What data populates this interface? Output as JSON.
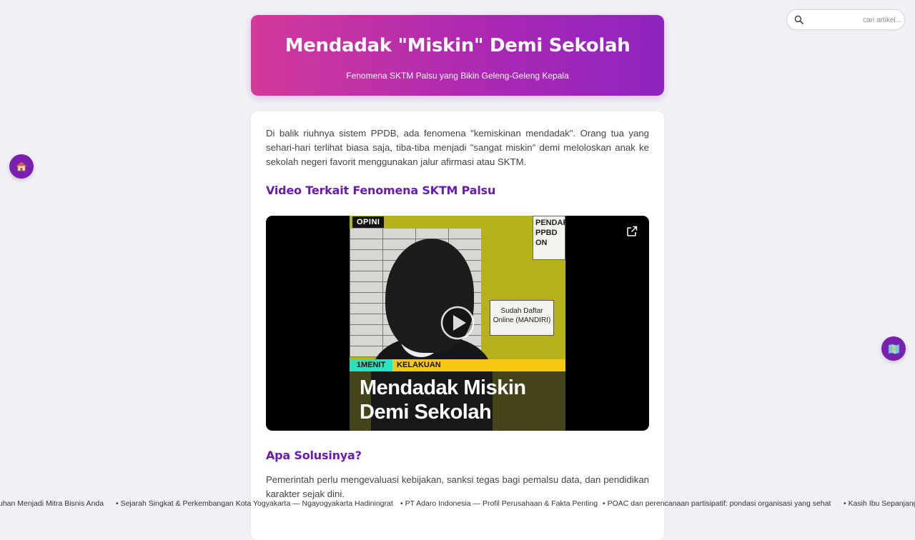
{
  "header": {
    "title": "Mendadak \"Miskin\" Demi Sekolah",
    "subtitle": "Fenomena SKTM Palsu yang Bikin Geleng-Geleng Kepala"
  },
  "search": {
    "placeholder": "cari artikel...",
    "icon": "search-icon"
  },
  "floating": {
    "home_icon": "house-icon",
    "map_icon": "map-icon",
    "accent": "#7a1fb0"
  },
  "article": {
    "intro": "Di balik riuhnya sistem PPDB, ada fenomena \"kemiskinan mendadak\". Orang tua yang sehari-hari terlihat biasa saja, tiba-tiba menjadi \"sangat miskin\" demi meloloskan anak ke sekolah negeri favorit menggunakan jalur afirmasi atau SKTM.",
    "video_heading": "Video Terkait Fenomena SKTM Palsu",
    "solution_heading": "Apa Solusinya?",
    "solution_text": "Pemerintah perlu mengevaluasi kebijakan, sanksi tegas bagi pemalsu data, dan pendidikan karakter sejak dini."
  },
  "video": {
    "logo": "OPINI",
    "notice_top": "PENDAF PPBD ON",
    "notice_mid": "Sudah Daftar Online (MANDIRI)",
    "tag1": "1MENIT",
    "tag2": "KELAKUAN",
    "title_line1": "Mendadak Miskin",
    "title_line2": "Demi Sekolah",
    "play_icon": "play-icon",
    "external_icon": "external-link-icon"
  },
  "ticker": [
    "uhan Menjadi Mitra Bisnis Anda",
    "• Sejarah Singkat & Perkembangan Kota Yogyakarta — Ngayogyakarta Hadiningrat",
    "• PT Adaro Indonesia — Profil Perusahaan & Fakta Penting",
    "• POAC dan perencanaan partisipatif: pondasi organisasi yang sehat",
    "• Kasih Ibu Sepanjang"
  ],
  "colors": {
    "gradient_start": "#d23a9a",
    "gradient_end": "#8e24c0",
    "heading": "#6a1bb0",
    "page_bg": "#f0f1f5"
  }
}
